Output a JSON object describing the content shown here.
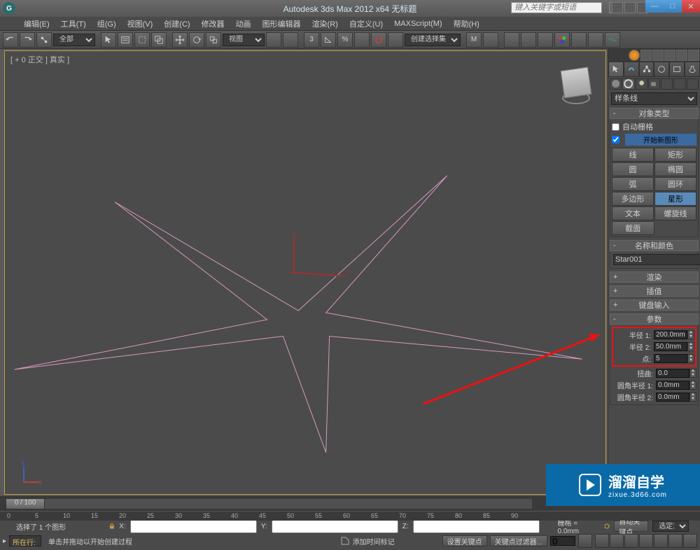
{
  "title": "Autodesk 3ds Max 2012 x64   无标题",
  "search_placeholder": "键入关键字或短语",
  "menus": [
    "编辑(E)",
    "工具(T)",
    "组(G)",
    "视图(V)",
    "创建(C)",
    "修改器",
    "动画",
    "图形编辑器",
    "渲染(R)",
    "自定义(U)",
    "MAXScript(M)",
    "帮助(H)"
  ],
  "toolbar": {
    "layer_dd": "全部",
    "view_dd": "视图",
    "selset_dd": "创建选择集"
  },
  "viewport": {
    "label": "[ + 0 正交 ] 真实 ]"
  },
  "cmdpanel": {
    "shape_dd": "样条线",
    "rollouts": {
      "object_type_title": "对象类型",
      "auto_grid": "自动栅格",
      "new_shape": "开始新图形",
      "shapes": [
        "线",
        "矩形",
        "圆",
        "椭圆",
        "弧",
        "圆环",
        "多边形",
        "星形",
        "文本",
        "螺旋线",
        "截面"
      ],
      "active_shape_index": 7,
      "name_color_title": "名称和颜色",
      "object_name": "Star001",
      "color": "#e89ec8",
      "collapsed": [
        "渲染",
        "插值",
        "键盘输入"
      ],
      "params_title": "参数",
      "params": {
        "radius1_label": "半径 1:",
        "radius1_value": "200.0mm",
        "radius2_label": "半径 2:",
        "radius2_value": "50.0mm",
        "points_label": "点:",
        "points_value": "5",
        "twist_label": "扭曲:",
        "twist_value": "0.0",
        "fillet1_label": "圆角半径 1:",
        "fillet1_value": "0.0mm",
        "fillet2_label": "圆角半径 2:",
        "fillet2_value": "0.0mm"
      }
    }
  },
  "timeline": {
    "frame_label": "0 / 100"
  },
  "status": {
    "selection_info": "选择了 1 个图形",
    "hint": "单击并拖动以开始创建过程",
    "prompt_label": "所在行:",
    "x": "",
    "y": "",
    "z": "",
    "grid": "栅格 = 0.0mm",
    "autokey": "自动关键点",
    "selset2": "选定对象",
    "setkey": "设置关键点",
    "keyfilter": "关键点过滤器...",
    "addtime": "添加时间标记"
  },
  "watermark": {
    "big": "溜溜自学",
    "small": "zixue.3d66.com"
  }
}
